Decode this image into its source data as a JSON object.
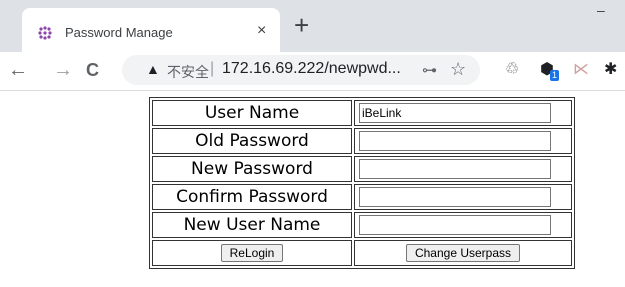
{
  "browser": {
    "tab": {
      "title": "Password Manage",
      "close_glyph": "×",
      "favicon": "grid-dots-icon"
    },
    "new_tab_glyph": "+",
    "window_min_glyph": "–",
    "nav": {
      "back": "←",
      "forward": "→",
      "reload": "C"
    },
    "omnibox": {
      "warning_glyph": "▲",
      "insecure_label": "不安全",
      "separator": "|",
      "url": "172.16.69.222/newpwd...",
      "key_glyph": "⊶",
      "star_glyph": "☆"
    },
    "extensions": {
      "ext1": "♲",
      "ext2": "⬢",
      "ext2_badge": "1",
      "ext3": "⋉",
      "puzzle": "✱"
    }
  },
  "form": {
    "user_name_label": "User Name",
    "user_name_value": "iBeLink",
    "old_password_label": "Old Password",
    "new_password_label": "New Password",
    "confirm_password_label": "Confirm Password",
    "new_user_name_label": "New User Name",
    "relogin_button": "ReLogin",
    "change_button": "Change Userpass"
  }
}
